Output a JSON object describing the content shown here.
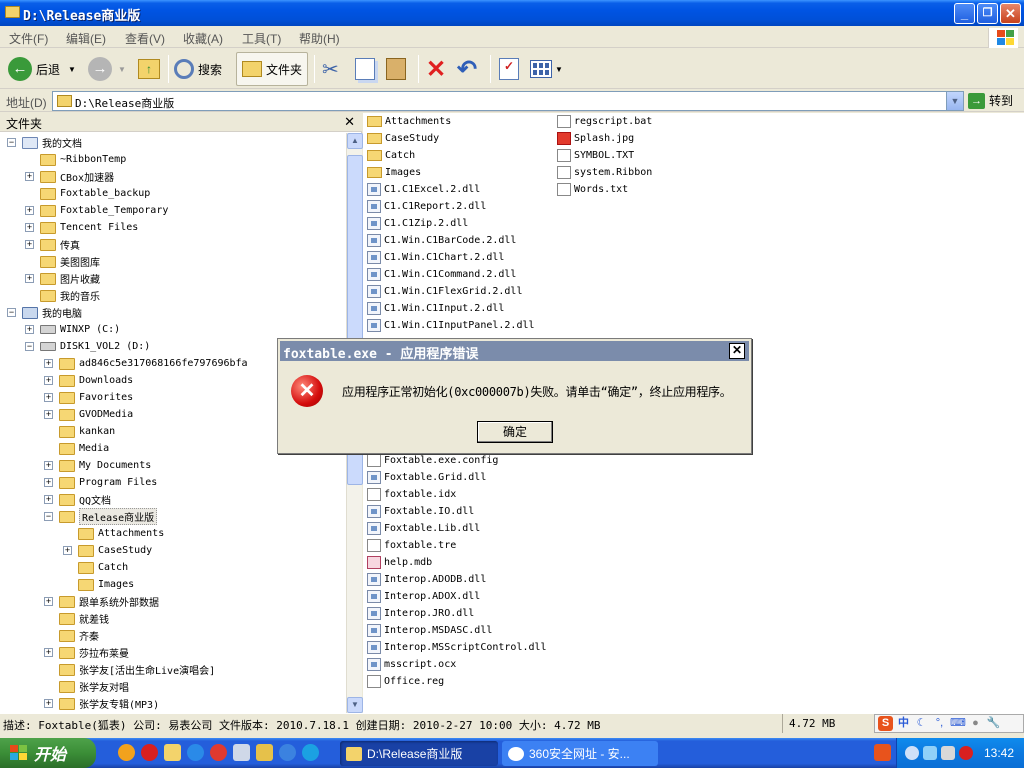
{
  "window": {
    "title": "D:\\Release商业版",
    "buttons": {
      "minimize": "_",
      "maximize": "❐",
      "close": "✕"
    }
  },
  "menu": [
    "文件(F)",
    "编辑(E)",
    "查看(V)",
    "收藏(A)",
    "工具(T)",
    "帮助(H)"
  ],
  "toolbar": {
    "back": "后退",
    "search": "搜索",
    "folders": "文件夹"
  },
  "address": {
    "label": "地址(D)",
    "value": "D:\\Release商业版",
    "go": "转到"
  },
  "folders_pane": {
    "title": "文件夹",
    "close": "✕",
    "tree": [
      {
        "label": "我的文档",
        "level": 0,
        "expander": "−",
        "icon": "doc"
      },
      {
        "label": "~RibbonTemp",
        "level": 1,
        "expander": "",
        "icon": "folder"
      },
      {
        "label": "CBox加速器",
        "level": 1,
        "expander": "+",
        "icon": "folder"
      },
      {
        "label": "Foxtable_backup",
        "level": 1,
        "expander": "",
        "icon": "folder"
      },
      {
        "label": "Foxtable_Temporary",
        "level": 1,
        "expander": "+",
        "icon": "folder"
      },
      {
        "label": "Tencent Files",
        "level": 1,
        "expander": "+",
        "icon": "folder"
      },
      {
        "label": "传真",
        "level": 1,
        "expander": "+",
        "icon": "folder"
      },
      {
        "label": "美图图库",
        "level": 1,
        "expander": "",
        "icon": "folder"
      },
      {
        "label": "图片收藏",
        "level": 1,
        "expander": "+",
        "icon": "folder"
      },
      {
        "label": "我的音乐",
        "level": 1,
        "expander": "",
        "icon": "music"
      },
      {
        "label": "我的电脑",
        "level": 0,
        "expander": "−",
        "icon": "pc"
      },
      {
        "label": "WINXP (C:)",
        "level": 1,
        "expander": "+",
        "icon": "drive"
      },
      {
        "label": "DISK1_VOL2 (D:)",
        "level": 1,
        "expander": "−",
        "icon": "drive"
      },
      {
        "label": "ad846c5e317068166fe797696bfa",
        "level": 2,
        "expander": "+",
        "icon": "folder"
      },
      {
        "label": "Downloads",
        "level": 2,
        "expander": "+",
        "icon": "folder"
      },
      {
        "label": "Favorites",
        "level": 2,
        "expander": "+",
        "icon": "folder"
      },
      {
        "label": "GVODMedia",
        "level": 2,
        "expander": "+",
        "icon": "folder"
      },
      {
        "label": "kankan",
        "level": 2,
        "expander": "",
        "icon": "folder"
      },
      {
        "label": "Media",
        "level": 2,
        "expander": "",
        "icon": "folder"
      },
      {
        "label": "My Documents",
        "level": 2,
        "expander": "+",
        "icon": "folder"
      },
      {
        "label": "Program Files",
        "level": 2,
        "expander": "+",
        "icon": "folder"
      },
      {
        "label": "QQ文档",
        "level": 2,
        "expander": "+",
        "icon": "folder"
      },
      {
        "label": "Release商业版",
        "level": 2,
        "expander": "−",
        "icon": "folder",
        "selected": true
      },
      {
        "label": "Attachments",
        "level": 3,
        "expander": "",
        "icon": "folder"
      },
      {
        "label": "CaseStudy",
        "level": 3,
        "expander": "+",
        "icon": "folder"
      },
      {
        "label": "Catch",
        "level": 3,
        "expander": "",
        "icon": "folder"
      },
      {
        "label": "Images",
        "level": 3,
        "expander": "",
        "icon": "folder"
      },
      {
        "label": "跟单系统外部数据",
        "level": 2,
        "expander": "+",
        "icon": "folder"
      },
      {
        "label": "就差钱",
        "level": 2,
        "expander": "",
        "icon": "folder"
      },
      {
        "label": "齐秦",
        "level": 2,
        "expander": "",
        "icon": "folder"
      },
      {
        "label": "莎拉布莱曼",
        "level": 2,
        "expander": "+",
        "icon": "folder"
      },
      {
        "label": "张学友[活出生命Live演唱会]",
        "level": 2,
        "expander": "",
        "icon": "folder"
      },
      {
        "label": "张学友对唱",
        "level": 2,
        "expander": "",
        "icon": "folder"
      },
      {
        "label": "张学友专辑(MP3)",
        "level": 2,
        "expander": "+",
        "icon": "folder"
      }
    ]
  },
  "files": {
    "column1": [
      {
        "name": "Attachments",
        "icon": "folder"
      },
      {
        "name": "CaseStudy",
        "icon": "folder"
      },
      {
        "name": "Catch",
        "icon": "folder"
      },
      {
        "name": "Images",
        "icon": "folder"
      },
      {
        "name": "C1.C1Excel.2.dll",
        "icon": "dll"
      },
      {
        "name": "C1.C1Report.2.dll",
        "icon": "dll"
      },
      {
        "name": "C1.C1Zip.2.dll",
        "icon": "dll"
      },
      {
        "name": "C1.Win.C1BarCode.2.dll",
        "icon": "dll"
      },
      {
        "name": "C1.Win.C1Chart.2.dll",
        "icon": "dll"
      },
      {
        "name": "C1.Win.C1Command.2.dll",
        "icon": "dll"
      },
      {
        "name": "C1.Win.C1FlexGrid.2.dll",
        "icon": "dll"
      },
      {
        "name": "C1.Win.C1Input.2.dll",
        "icon": "dll"
      },
      {
        "name": "C1.Win.C1InputPanel.2.dll",
        "icon": "dll"
      }
    ],
    "column1_lower": [
      {
        "name": "Foxtable.exe.config",
        "icon": "txt"
      },
      {
        "name": "Foxtable.Grid.dll",
        "icon": "dll"
      },
      {
        "name": "foxtable.idx",
        "icon": "txt"
      },
      {
        "name": "Foxtable.IO.dll",
        "icon": "dll"
      },
      {
        "name": "Foxtable.Lib.dll",
        "icon": "dll"
      },
      {
        "name": "foxtable.tre",
        "icon": "txt"
      },
      {
        "name": "help.mdb",
        "icon": "mdb"
      },
      {
        "name": "Interop.ADODB.dll",
        "icon": "dll"
      },
      {
        "name": "Interop.ADOX.dll",
        "icon": "dll"
      },
      {
        "name": "Interop.JRO.dll",
        "icon": "dll"
      },
      {
        "name": "Interop.MSDASC.dll",
        "icon": "dll"
      },
      {
        "name": "Interop.MSScriptControl.dll",
        "icon": "dll"
      },
      {
        "name": "msscript.ocx",
        "icon": "dll"
      },
      {
        "name": "Office.reg",
        "icon": "txt"
      }
    ],
    "column2": [
      {
        "name": "regscript.bat",
        "icon": "txt"
      },
      {
        "name": "Splash.jpg",
        "icon": "img"
      },
      {
        "name": "SYMBOL.TXT",
        "icon": "txt"
      },
      {
        "name": "system.Ribbon",
        "icon": "txt"
      },
      {
        "name": "Words.txt",
        "icon": "txt"
      }
    ]
  },
  "dialog": {
    "title": "foxtable.exe - 应用程序错误",
    "message": "应用程序正常初始化(0xc000007b)失败。请单击“确定”，终止应用程序。",
    "ok": "确定",
    "close": "✕",
    "error_icon": "✕"
  },
  "status": {
    "description": "描述: Foxtable(狐表) 公司: 易表公司 文件版本: 2010.7.18.1 创建日期: 2010-2-27 10:00 大小: 4.72 MB",
    "size": "4.72 MB",
    "ime": [
      "S",
      "中",
      "☾",
      "°,",
      "⌨",
      "●",
      "🔧"
    ]
  },
  "taskbar": {
    "start": "开始",
    "tasks": [
      "D:\\Release商业版",
      "360安全网址 - 安..."
    ],
    "clock": "13:42"
  },
  "colors": {
    "title_blue": "#0054e3",
    "error_red": "#d40c0c",
    "taskbar_blue": "#245edb",
    "start_green": "#3b8e37"
  }
}
